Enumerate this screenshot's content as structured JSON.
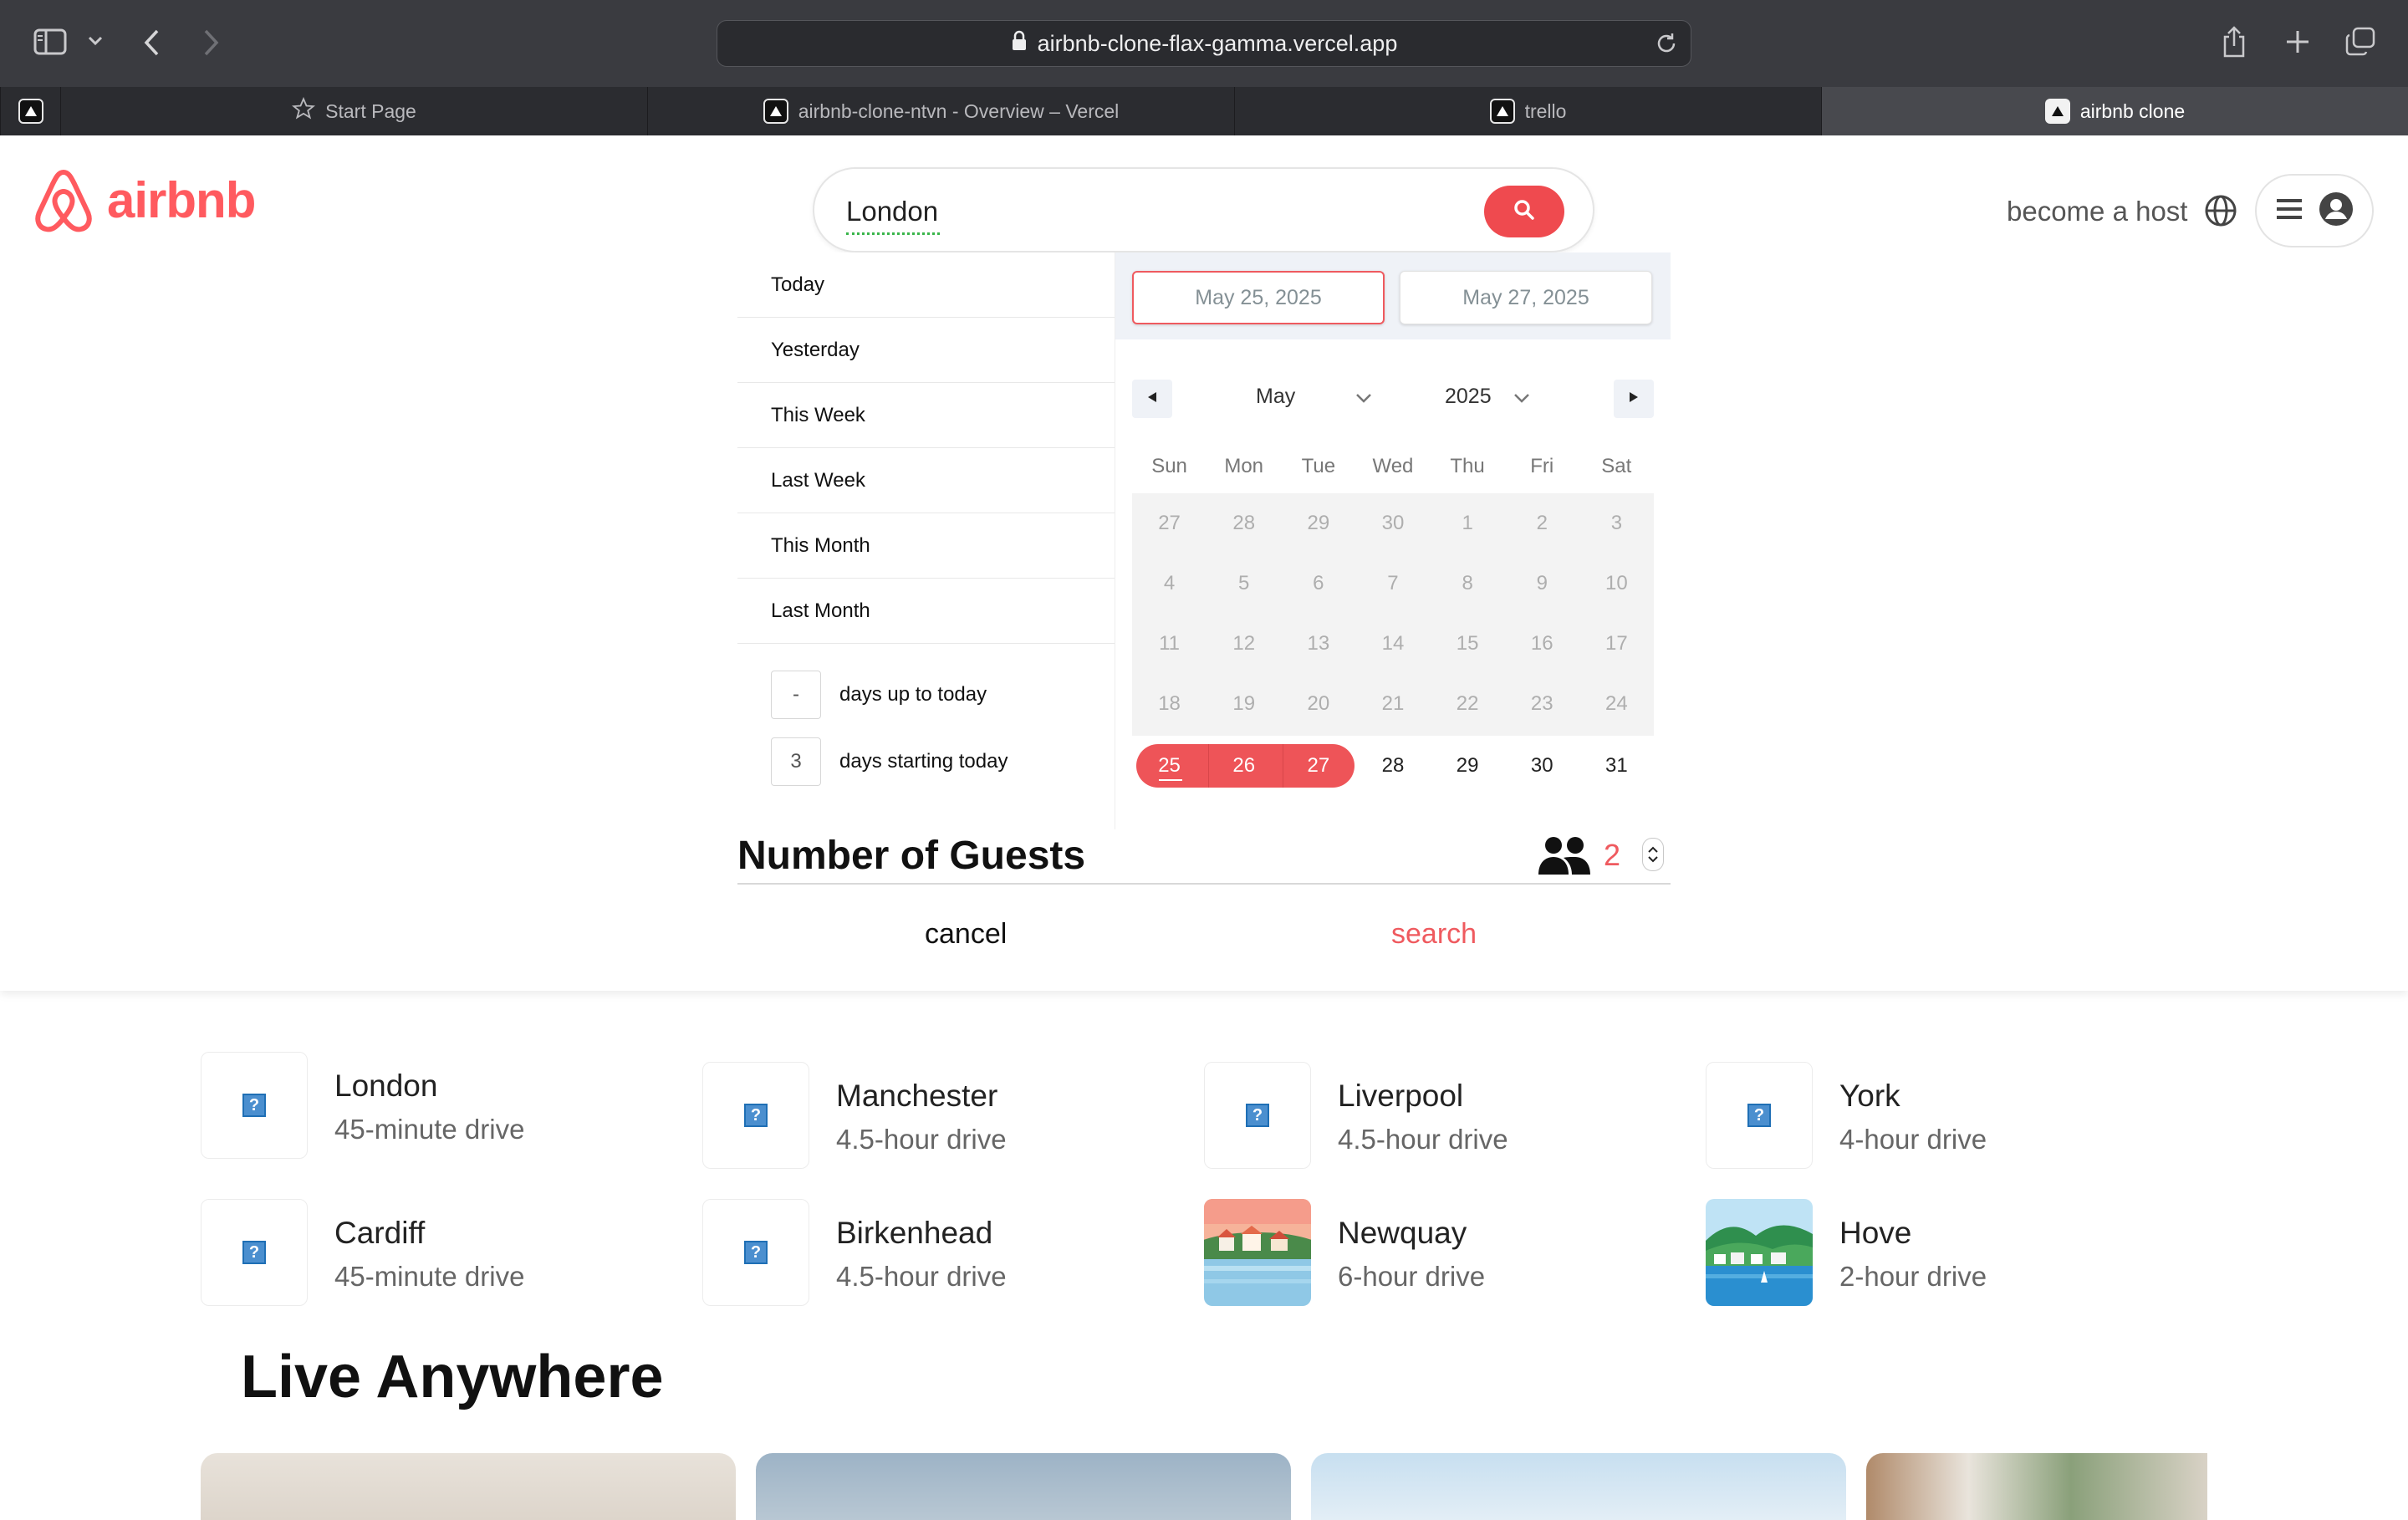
{
  "browser": {
    "url": "airbnb-clone-flax-gamma.vercel.app",
    "tabs": [
      {
        "label": "Start Page"
      },
      {
        "label": "airbnb-clone-ntvn - Overview – Vercel"
      },
      {
        "label": "trello"
      },
      {
        "label": "airbnb clone",
        "active": true
      }
    ]
  },
  "header": {
    "logo_text": "airbnb",
    "search_value": "London",
    "host_link": "become a host"
  },
  "date_picker": {
    "ranges": [
      "Today",
      "Yesterday",
      "This Week",
      "Last Week",
      "This Month",
      "Last Month"
    ],
    "days_up_to_today": {
      "value": "-",
      "label": "days up to today"
    },
    "days_starting_today": {
      "value": "3",
      "label": "days starting today"
    },
    "start_date": "May 25, 2025",
    "end_date": "May 27, 2025",
    "month": "May",
    "year": "2025",
    "weekdays": [
      "Sun",
      "Mon",
      "Tue",
      "Wed",
      "Thu",
      "Fri",
      "Sat"
    ],
    "weeks": [
      [
        "27",
        "28",
        "29",
        "30",
        "1",
        "2",
        "3"
      ],
      [
        "4",
        "5",
        "6",
        "7",
        "8",
        "9",
        "10"
      ],
      [
        "11",
        "12",
        "13",
        "14",
        "15",
        "16",
        "17"
      ],
      [
        "18",
        "19",
        "20",
        "21",
        "22",
        "23",
        "24"
      ],
      [
        "25",
        "26",
        "27",
        "28",
        "29",
        "30",
        "31"
      ]
    ],
    "selected": [
      "25",
      "26",
      "27"
    ]
  },
  "guests": {
    "title": "Number of Guests",
    "count": "2"
  },
  "actions": {
    "cancel": "cancel",
    "search": "search"
  },
  "destinations": [
    {
      "name": "London",
      "distance": "45-minute drive",
      "image": "broken"
    },
    {
      "name": "Manchester",
      "distance": "4.5-hour drive",
      "image": "broken"
    },
    {
      "name": "Liverpool",
      "distance": "4.5-hour drive",
      "image": "broken"
    },
    {
      "name": "York",
      "distance": "4-hour drive",
      "image": "broken"
    },
    {
      "name": "Cardiff",
      "distance": "45-minute drive",
      "image": "broken"
    },
    {
      "name": "Birkenhead",
      "distance": "4.5-hour drive",
      "image": "broken"
    },
    {
      "name": "Newquay",
      "distance": "6-hour drive",
      "image": "coastal-town-illustration"
    },
    {
      "name": "Hove",
      "distance": "2-hour drive",
      "image": "seaside-hills-illustration"
    }
  ],
  "live_anywhere": {
    "title": "Live Anywhere"
  },
  "colors": {
    "brand": "#ff5a5f",
    "accent": "#ef4a4f"
  },
  "icons": [
    "sidebar-icon",
    "chevron-down-icon",
    "back-icon",
    "forward-icon",
    "lock-icon",
    "reload-icon",
    "share-icon",
    "new-tab-icon",
    "tabs-overview-icon",
    "search-icon",
    "globe-icon",
    "menu-icon",
    "user-icon",
    "people-icon"
  ]
}
